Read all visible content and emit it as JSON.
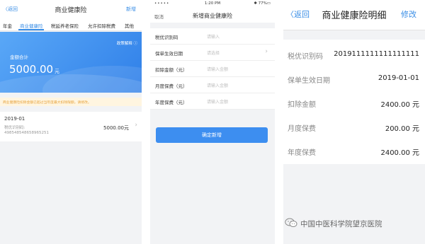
{
  "panel1": {
    "back_label": "〈返回",
    "title": "商业健康险",
    "right_label": "新增",
    "tabs": [
      {
        "label": "年金"
      },
      {
        "label": "商业健康险"
      },
      {
        "label": "税延养老保险"
      },
      {
        "label": "允许扣除税费"
      },
      {
        "label": "其他"
      }
    ],
    "active_tab_index": 1,
    "policy_link": "政策解释 ⓘ",
    "sum_label": "金额合计",
    "sum_value": "5000.00",
    "sum_unit": "元",
    "notice": "商业健康险扣除金额已超过当年度最大扣除限额，请修改。",
    "record": {
      "date": "2019-01",
      "code_label": "税优识别码:",
      "code_value": "498548548658965251",
      "amount": "5000.00元"
    }
  },
  "panel2": {
    "signal": "•••••",
    "time": "1:20 PM",
    "battery": "✱ 77%▭",
    "cancel_label": "取消",
    "title": "新增商业健康险",
    "fields": [
      {
        "label": "税优识别码",
        "placeholder": "请输入"
      },
      {
        "label": "保单生效日期",
        "placeholder": "请选择"
      },
      {
        "label": "扣除金额（元）",
        "placeholder": "请输入金额"
      },
      {
        "label": "月度保费（元）",
        "placeholder": "请输入金额"
      },
      {
        "label": "年度保费（元）",
        "placeholder": "请输入金额"
      }
    ],
    "submit_label": "确定新增"
  },
  "panel3": {
    "back_label": "〈返回",
    "title": "商业健康险明细",
    "edit_label": "修改",
    "details": [
      {
        "key": "税优识别码",
        "value": "2019111111111111111"
      },
      {
        "key": "保单生效日期",
        "value": "2019-01-01"
      },
      {
        "key": "扣除金额",
        "value": "2400.00 元"
      },
      {
        "key": "月度保费",
        "value": "200.00 元"
      },
      {
        "key": "年度保费",
        "value": "2400.00 元"
      }
    ],
    "watermark": "中国中医科学院望京医院"
  }
}
